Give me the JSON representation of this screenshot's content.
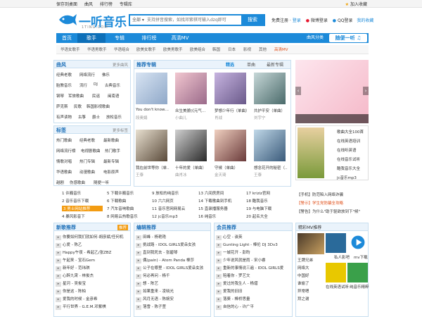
{
  "topbar": {
    "links": [
      "保存到桌面",
      "曲风",
      "排行榜",
      "专辑库"
    ],
    "favorite": "加入收藏"
  },
  "logo": {
    "text": "一听音乐",
    "url": "1TING.COM"
  },
  "search": {
    "scope": "全部",
    "placeholder": "支持拼音搜索，如找邓紫棋可输入dzq即可",
    "button": "搜索"
  },
  "login": {
    "register": "免费注册",
    "login": "登录",
    "weibo": "微博登录",
    "qq": "QQ登录",
    "favorites": "我的收藏"
  },
  "nav": {
    "items": [
      "首页",
      "歌手",
      "专辑",
      "排行榜",
      "高清MV"
    ],
    "classify": "曲风分类",
    "listen": "随便一听"
  },
  "subnav": [
    "华语女歌手",
    "华语男歌手",
    "华语组合",
    "欧美女歌手",
    "欧美男歌手",
    "欧美组合",
    "韩国",
    "日本",
    "影视",
    "其他",
    "高清MV"
  ],
  "genre": {
    "title": "曲风",
    "more": "更多曲风",
    "rows": [
      [
        "经典老歌",
        "网络流行",
        "佛乐"
      ],
      [
        "胎教音乐",
        "流行",
        "DJ",
        "古典音乐"
      ],
      [
        "钢琴",
        "军旅歌曲",
        "民谣",
        "闽南语"
      ],
      [
        "萨克斯",
        "民歌",
        "韩国影视歌曲"
      ],
      [
        "有声读物",
        "古筝",
        "爵士",
        "放松音乐"
      ]
    ]
  },
  "tags": {
    "title": "标签",
    "more": "更多标签",
    "rows": [
      [
        "热门歌曲",
        "经典老歌",
        "最新歌曲"
      ],
      [
        "网络流行榜",
        "电视剧歌曲",
        "热门歌手"
      ],
      [
        "情歌对唱",
        "热门专辑",
        "最新专辑"
      ],
      [
        "华语歌曲",
        "动漫歌曲",
        "电影原声"
      ],
      [
        "越剧",
        "伤感歌曲",
        "随便一听"
      ]
    ]
  },
  "albums": {
    "title": "推荐专辑",
    "tabs": [
      "精选",
      "单曲",
      "最新专辑"
    ],
    "items": [
      {
        "title": "You don't know…",
        "artist": "段奥娟"
      },
      {
        "title": "众生美貌(《元气…",
        "artist": "小曲儿"
      },
      {
        "title": "梦想少年行（单曲）",
        "artist": "肖战"
      },
      {
        "title": "共护平安（单曲）",
        "artist": "刘宇宁"
      },
      {
        "title": "我在前世等你（单…",
        "artist": "王泰"
      },
      {
        "title": "十年的爱（单曲）",
        "artist": "曲肖冰"
      },
      {
        "title": "守候（单曲）",
        "artist": "金天琦"
      },
      {
        "title": "想念花开的秘密（…",
        "artist": "王泰"
      }
    ]
  },
  "rank": {
    "col1": [
      "1 许巍音乐",
      "2 音乐音乐下载",
      "3 男士网站推荐",
      "4 暴风影音下"
    ],
    "col2": [
      "5 下载许巍音乐",
      "6 下载歌曲",
      "7 汽车音响歌曲",
      "8 网易云热歌音乐"
    ],
    "col3": [
      "9 放松的纯音乐",
      "10 六六网页",
      "11 音乐官网网易云",
      "12 jc音乐mp3"
    ],
    "col4": [
      "13 六间房房间",
      "14 下载歌曲到手机",
      "15 直录播服务器",
      "16 纯音乐"
    ],
    "col5": [
      "17 kriziz官网",
      "18 酷我音乐",
      "19 与电脑下载",
      "20 起名大全"
    ]
  },
  "promo": {
    "items": [
      "歌曲大全100首",
      "在线英语培训",
      "在线听英语",
      "在线音乐试听",
      "酷我音乐大全",
      "jc音乐mp3"
    ],
    "news": [
      "【手机】防范陷入网络诈骗",
      "【警示】学生党防骗全攻略",
      "【警告】为什么\"助于驱欲放到下\"候\""
    ]
  },
  "lists": {
    "newsong": {
      "title": "新歌推荐",
      "more": "推荐",
      "items": [
        "你要如何我们就如何-胡彦斌/任何机",
        "心爱 - 陈乙",
        "Happy午夜 - 希起乙/张ZBZ",
        "午起来 - 宝石Gem",
        "新年好 - 范玮琪",
        "心醉九霄 - 林俊杰",
        "星河 - 吴俊宝",
        "你是这 - 陈柏",
        "爱我的时候 - 金彦希",
        "平行世界 - G.E.M.邓紫棋"
      ]
    },
    "editor": {
      "title": "编辑推荐",
      "items": [
        "田峰 - 杨艳艳",
        "挑战路 - IDOL GIRLS爱朵女孩",
        "直到我死去 - 张碧琴",
        "偶(pain) - Atom Panda 棒莎",
        "公子在哪里 - IDOL GIRLS爱朵女孩",
        "何必再问 - 杨千",
        "想 - 陈艺",
        "如果重来 - 凌晓光",
        "风月无语 - 陈婉安",
        "落雪 - 陈子萱"
      ]
    },
    "vip": {
      "title": "会员推荐",
      "items": [
        "心空 - 诶英",
        "Gunting Light - 棒伦 DJ 3Dv3",
        "一城花开 - 彭昀",
        "少年说风就是雨 - 宋小睿",
        "重新的事情说三遍 - IDOL GIRLS爱",
        "陪着你 - 罗艺文",
        "爱过的我生人 - 杨熠",
        "爱我的旧旧",
        "落葵 - 棒桥思量",
        "自信的心 - 许广平"
      ]
    }
  },
  "mv": {
    "title": "精彩MV推荐",
    "tiles": [
      "私人影吧",
      "mv下载",
      "在线英语试听",
      "纯音乐精粹"
    ],
    "side": [
      "王牌兄弟",
      "网络大",
      "中国好",
      "谁偷了",
      "异常嗯",
      "拜之谢"
    ]
  }
}
